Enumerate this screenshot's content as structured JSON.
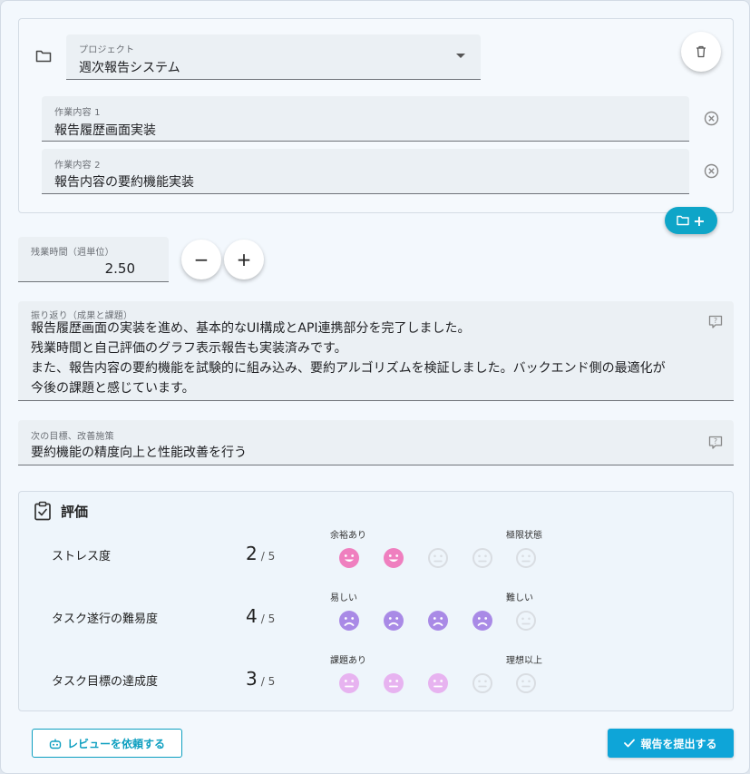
{
  "project": {
    "label": "プロジェクト",
    "value": "週次報告システム",
    "tasks": [
      {
        "label": "作業内容 1",
        "value": "報告履歴画面実装"
      },
      {
        "label": "作業内容 2",
        "value": "報告内容の要約機能実装"
      }
    ]
  },
  "overtime": {
    "label": "残業時間（週単位）",
    "value": "2.50",
    "decrement": "−",
    "increment": "+"
  },
  "reflection": {
    "label": "振り返り（成果と課題）",
    "value": "報告履歴画面の実装を進め、基本的なUI構成とAPI連携部分を完了しました。\n残業時間と自己評価のグラフ表示報告も実装済みです。\nまた、報告内容の要約機能を試験的に組み込み、要約アルゴリズムを検証しました。バックエンド側の最適化が\n今後の課題と感じています。"
  },
  "next_goal": {
    "label": "次の目標、改善施策",
    "value": "要約機能の精度向上と性能改善を行う"
  },
  "evaluation": {
    "title": "評価",
    "rows": [
      {
        "label": "ストレス度",
        "score": "2",
        "max": "/ 5",
        "low": "余裕あり",
        "high": "極限状態",
        "filled": 2,
        "color": "#ef7fbf",
        "mood": "smile"
      },
      {
        "label": "タスク遂行の難易度",
        "score": "4",
        "max": "/ 5",
        "low": "易しい",
        "high": "難しい",
        "filled": 4,
        "color": "#a98ae6",
        "mood": "sad"
      },
      {
        "label": "タスク目標の達成度",
        "score": "3",
        "max": "/ 5",
        "low": "課題あり",
        "high": "理想以上",
        "filled": 3,
        "color": "#e7b3f0",
        "mood": "neutral"
      }
    ]
  },
  "actions": {
    "review": "レビューを依頼する",
    "submit": "報告を提出する"
  },
  "colors": {
    "accent": "#0ea5c8",
    "empty_face": "#d9dde2"
  },
  "icons": [
    "folder-icon",
    "dropdown-arrow-icon",
    "trash-icon",
    "clear-icon",
    "folder-add-icon",
    "help-icon",
    "clipboard-check-icon",
    "robot-icon",
    "check-icon"
  ]
}
